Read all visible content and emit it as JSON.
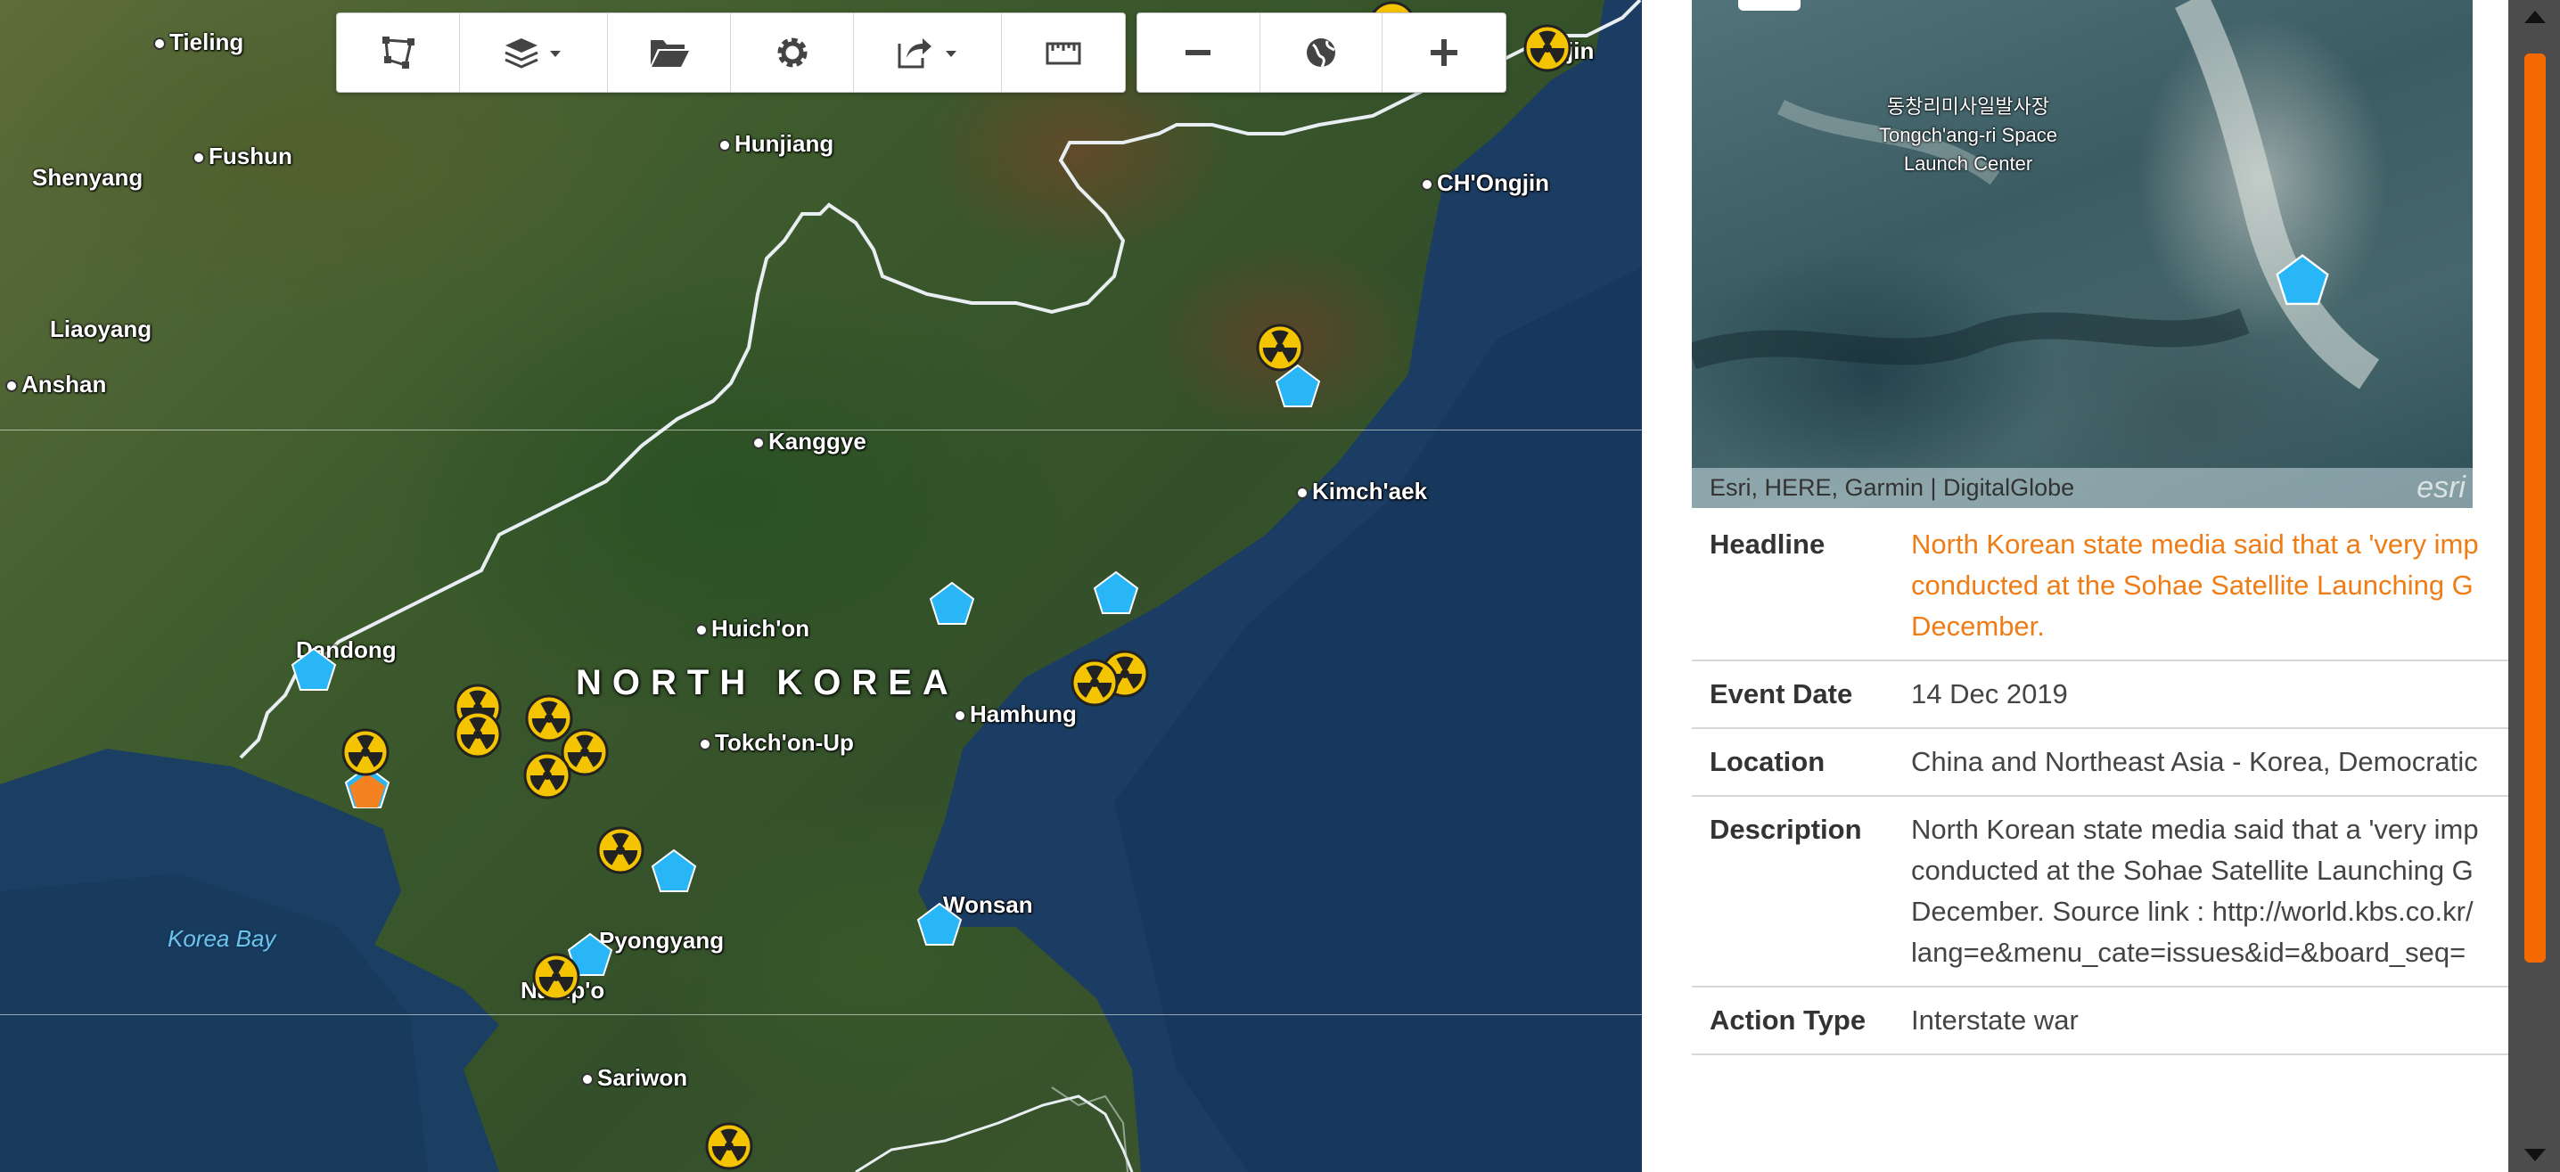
{
  "map": {
    "country_label": "NORTH KOREA",
    "water_label": "Korea Bay",
    "cities": [
      {
        "id": "tieling",
        "name": "Tieling"
      },
      {
        "id": "fushun",
        "name": "Fushun"
      },
      {
        "id": "shenyang",
        "name": "Shenyang"
      },
      {
        "id": "hunjiang",
        "name": "Hunjiang"
      },
      {
        "id": "chongjin",
        "name": "CH'Ongjin"
      },
      {
        "id": "liaoyang",
        "name": "Liaoyang"
      },
      {
        "id": "anshan",
        "name": "Anshan"
      },
      {
        "id": "kanggye",
        "name": "Kanggye"
      },
      {
        "id": "kimchaek",
        "name": "Kimch'aek"
      },
      {
        "id": "huichon",
        "name": "Huich'on"
      },
      {
        "id": "dandong",
        "name": "Dandong"
      },
      {
        "id": "hamhung",
        "name": "Hamhung"
      },
      {
        "id": "tokchon",
        "name": "Tokch'on-Up"
      },
      {
        "id": "wonsan",
        "name": "Wonsan"
      },
      {
        "id": "pyongyang",
        "name": "Pyongyang"
      },
      {
        "id": "nampo",
        "name": "Namp'o"
      },
      {
        "id": "sariwon",
        "name": "Sariwon"
      },
      {
        "id": "jin",
        "name": "jin"
      }
    ],
    "marker_colors": {
      "nuclear": "#f5c400",
      "event": "#29b6f6",
      "selected": "#f58220"
    }
  },
  "toolbar": {
    "icons": [
      "polygon-select-icon",
      "layers-icon",
      "folder-icon",
      "gear-icon",
      "share-icon",
      "measure-icon"
    ],
    "zoom_icons": [
      "zoom-out-icon",
      "globe-icon",
      "zoom-in-icon"
    ]
  },
  "panel": {
    "thumbnail": {
      "label_korean": "동창리미사일발사장",
      "label_line1": "Tongch'ang-ri Space",
      "label_line2": "Launch Center",
      "attribution": "Esri, HERE, Garmin | DigitalGlobe",
      "logo": "esri"
    },
    "rows": [
      {
        "key": "Headline",
        "lines": [
          "North Korean state media said that a 'very imp",
          "conducted at the Sohae Satellite Launching G",
          "December."
        ]
      },
      {
        "key": "Event Date",
        "lines": [
          "14 Dec 2019"
        ]
      },
      {
        "key": "Location",
        "lines": [
          "China and Northeast Asia - Korea, Democratic"
        ]
      },
      {
        "key": "Description",
        "lines": [
          "North Korean state media said that a 'very imp",
          "conducted at the Sohae Satellite Launching G",
          "December. Source link : http://world.kbs.co.kr/",
          "lang=e&menu_cate=issues&id=&board_seq="
        ]
      },
      {
        "key": "Action Type",
        "lines": [
          "Interstate war"
        ]
      }
    ]
  },
  "colors": {
    "accent": "#f56a00",
    "headline": "#f07c16"
  }
}
